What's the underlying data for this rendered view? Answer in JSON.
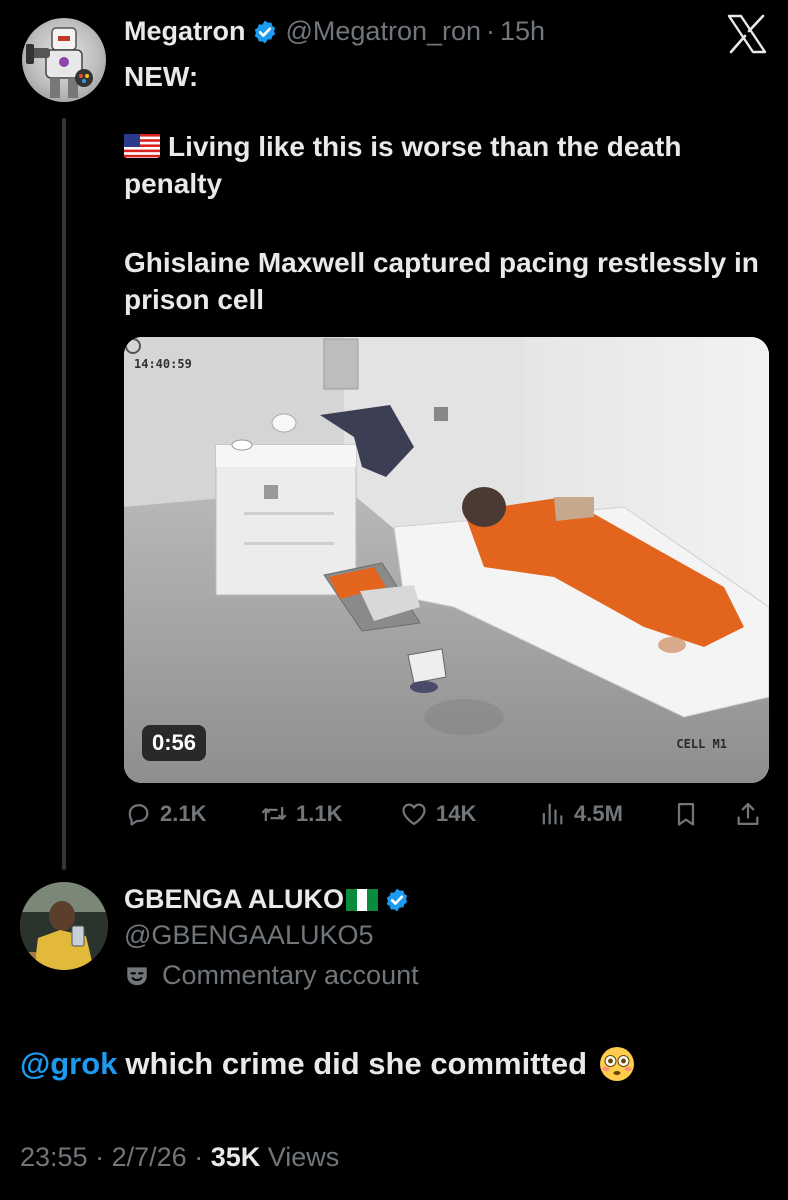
{
  "tweet": {
    "author_name": "Megatron",
    "author_handle": "@Megatron_ron",
    "separator": "·",
    "time_ago": "15h",
    "lead": "NEW:",
    "body_line1": "Living like this is worse than the death penalty",
    "body_line2": "Ghislaine Maxwell captured pacing restlessly in prison cell",
    "media": {
      "duration": "0:56",
      "overlay_time": "14:40:59",
      "overlay_label": "CELL M1"
    },
    "stats": {
      "replies": "2.1K",
      "reposts": "1.1K",
      "likes": "14K",
      "views": "4.5M"
    }
  },
  "reply": {
    "author_name": "GBENGA ALUKO",
    "author_handle": "@GBENGAALUKO5",
    "badge_label": "Commentary account",
    "mention": "@grok",
    "text": "which crime did she committed",
    "time": "23:55",
    "date": "2/7/26",
    "views_count": "35K",
    "views_label": "Views",
    "separator": "·"
  },
  "colors": {
    "background": "#000000",
    "text": "#e7e9ea",
    "muted": "#71767b",
    "accent": "#1d9bf0",
    "thread_line": "#333639"
  },
  "icons": [
    "verified-badge-icon",
    "x-logo-icon",
    "us-flag-icon",
    "reply-icon",
    "repost-icon",
    "heart-icon",
    "views-icon",
    "bookmark-icon",
    "share-icon",
    "nigeria-flag-icon",
    "theater-mask-icon",
    "flushed-face-emoji"
  ]
}
